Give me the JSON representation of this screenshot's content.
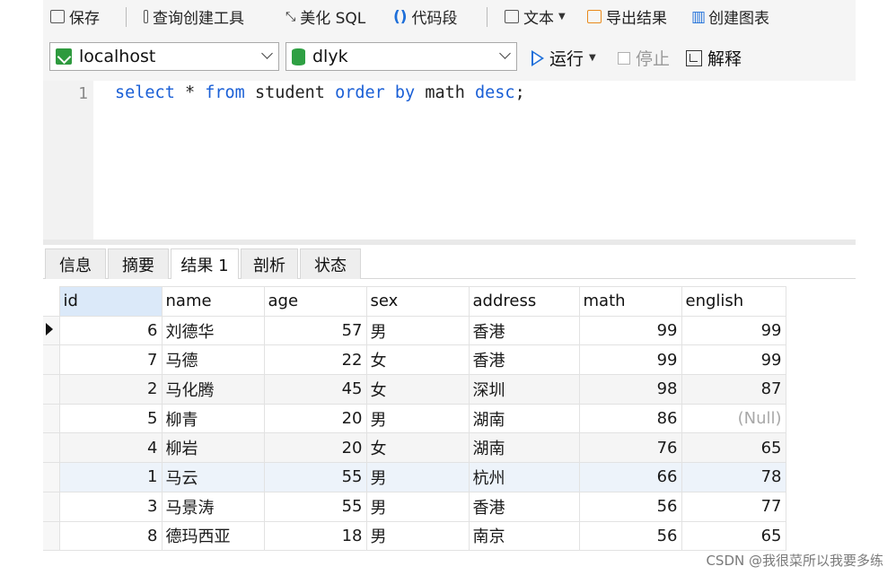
{
  "toolbar_top": {
    "save": "保存",
    "query_builder": "查询创建工具",
    "beautify": "美化 SQL",
    "snippet": "代码段",
    "text": "文本",
    "export": "导出结果",
    "create_chart": "创建图表"
  },
  "connection": {
    "host": "localhost",
    "database": "dlyk",
    "run": "运行",
    "stop": "停止",
    "explain": "解释"
  },
  "editor": {
    "line_number": "1",
    "tokens": [
      "select",
      " * ",
      "from",
      " student ",
      "order",
      " ",
      "by",
      " math ",
      "desc",
      ";"
    ]
  },
  "tabs": [
    "信息",
    "摘要",
    "结果 1",
    "剖析",
    "状态"
  ],
  "active_tab": "结果 1",
  "grid": {
    "columns": [
      "id",
      "name",
      "age",
      "sex",
      "address",
      "math",
      "english"
    ],
    "rows": [
      [
        "6",
        "刘德华",
        "57",
        "男",
        "香港",
        "99",
        "99"
      ],
      [
        "7",
        "马德",
        "22",
        "女",
        "香港",
        "99",
        "99"
      ],
      [
        "2",
        "马化腾",
        "45",
        "女",
        "深圳",
        "98",
        "87"
      ],
      [
        "5",
        "柳青",
        "20",
        "男",
        "湖南",
        "86",
        "(Null)"
      ],
      [
        "4",
        "柳岩",
        "20",
        "女",
        "湖南",
        "76",
        "65"
      ],
      [
        "1",
        "马云",
        "55",
        "男",
        "杭州",
        "66",
        "78"
      ],
      [
        "3",
        "马景涛",
        "55",
        "男",
        "香港",
        "56",
        "77"
      ],
      [
        "8",
        "德玛西亚",
        "18",
        "男",
        "南京",
        "56",
        "65"
      ]
    ]
  },
  "watermark": "CSDN @我很菜所以我要多练"
}
